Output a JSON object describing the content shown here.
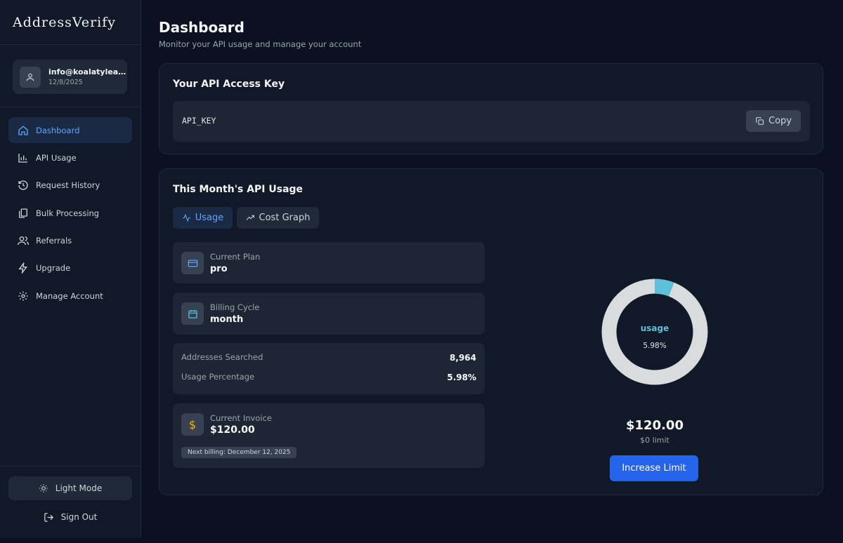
{
  "app": {
    "logo_text": "AddressVerify"
  },
  "user": {
    "email": "info@koalatylea…",
    "date": "12/8/2025"
  },
  "sidebar": {
    "items": [
      {
        "label": "Dashboard",
        "icon": "home-icon",
        "active": true
      },
      {
        "label": "API Usage",
        "icon": "bar-chart-icon",
        "active": false
      },
      {
        "label": "Request History",
        "icon": "history-icon",
        "active": false
      },
      {
        "label": "Bulk Processing",
        "icon": "files-icon",
        "active": false
      },
      {
        "label": "Referrals",
        "icon": "users-icon",
        "active": false
      },
      {
        "label": "Upgrade",
        "icon": "lightning-icon",
        "active": false
      },
      {
        "label": "Manage Account",
        "icon": "gear-icon",
        "active": false
      }
    ],
    "light_mode_label": "Light Mode",
    "sign_out_label": "Sign Out"
  },
  "header": {
    "title": "Dashboard",
    "subtitle": "Monitor your API usage and manage your account"
  },
  "api_key_card": {
    "title": "Your API Access Key",
    "key": "API_KEY",
    "copy_label": "Copy"
  },
  "usage_card": {
    "title": "This Month's API Usage",
    "tabs": [
      {
        "label": "Usage",
        "active": true
      },
      {
        "label": "Cost Graph",
        "active": false
      }
    ],
    "plan": {
      "label": "Current Plan",
      "value": "pro"
    },
    "cycle": {
      "label": "Billing Cycle",
      "value": "month"
    },
    "stats": {
      "addresses_label": "Addresses Searched",
      "addresses_value": "8,964",
      "percentage_label": "Usage Percentage",
      "percentage_value": "5.98%"
    },
    "invoice": {
      "label": "Current Invoice",
      "value": "$120.00",
      "next_billing": "Next billing: December 12, 2025"
    },
    "donut": {
      "center_label": "usage",
      "center_value": "5.98%",
      "usage_fraction": 0.0598,
      "track_color": "#d9dbdd",
      "fill_color": "#5bc0d8"
    },
    "amount": "$120.00",
    "limit": "$0 limit",
    "increase_label": "Increase Limit"
  },
  "colors": {
    "accent": "#60a5fa",
    "button_blue": "#2563eb",
    "invoice_icon": "#eab308"
  }
}
